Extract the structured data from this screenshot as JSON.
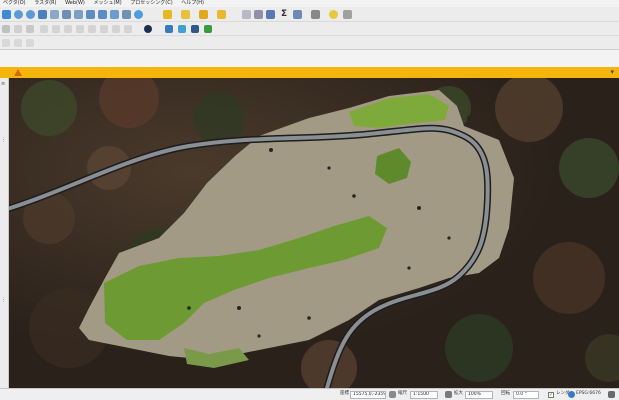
{
  "menu": {
    "items": [
      {
        "label": "ベクタ(O)"
      },
      {
        "label": "ラスタ(R)"
      },
      {
        "label": "Web(W)"
      },
      {
        "label": "メッシュ(M)"
      },
      {
        "label": "プロセッシング(C)"
      },
      {
        "label": "ヘルプ(H)"
      }
    ]
  },
  "toolbar": {
    "sigma_symbol": "Σ"
  },
  "warning": {
    "icon": "warning-icon",
    "close_symbol": "▾"
  },
  "statusbar": {
    "coordinate_label": "座標",
    "coordinate_value": "15575.0,-23599.7",
    "scale_label": "縮尺",
    "scale_value": "1:1500",
    "magnifier_label": "拡大",
    "magnifier_value": "100%",
    "rotation_label": "回転",
    "rotation_value": "0.0 °",
    "render_label": "レンダ",
    "crs_label": "EPSG:6676",
    "render_checked": "✓"
  },
  "colors": {
    "accent_warning": "#f5b50a",
    "forest_dark": "#3a2a22",
    "road": "#8a8f94",
    "clearing": "#a39a86",
    "vegetation": "#7eaa3c"
  }
}
